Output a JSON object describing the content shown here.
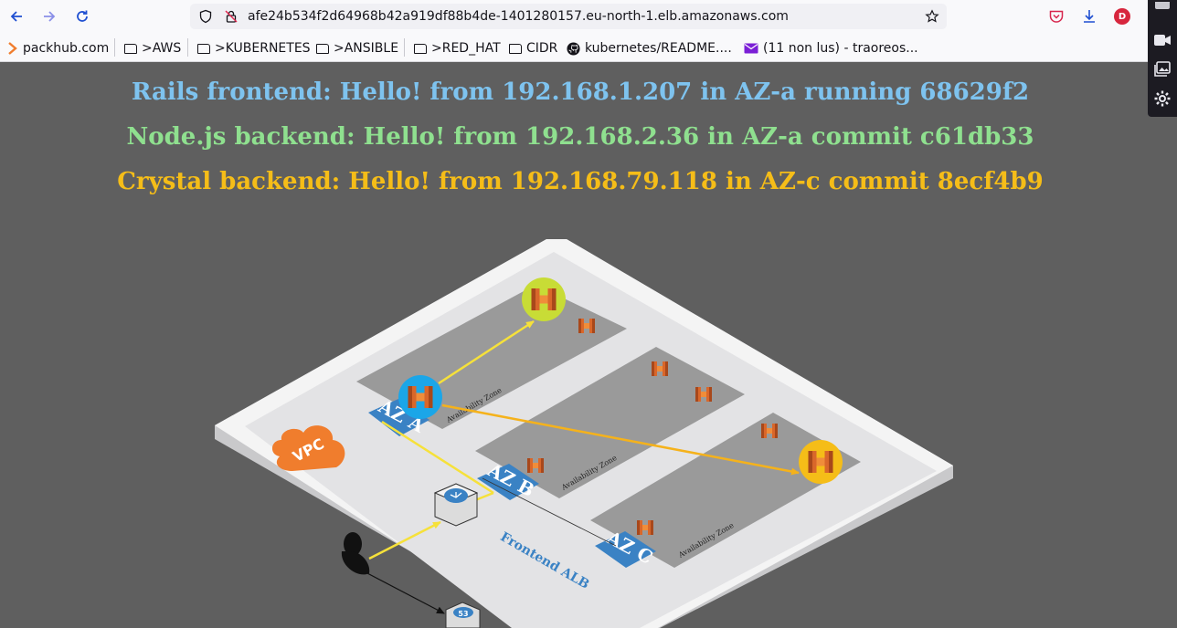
{
  "browser": {
    "url": "afe24b534f2d64968b42a919df88b4de-1401280157.eu-north-1.elb.amazonaws.com",
    "profile_initial": "D"
  },
  "bookmarks": [
    {
      "label": "packhub.com",
      "icon": "packhub-icon"
    },
    {
      "label": ">AWS",
      "icon": "folder-icon"
    },
    {
      "label": ">KUBERNETES",
      "icon": "folder-icon"
    },
    {
      "label": ">ANSIBLE",
      "icon": "folder-icon"
    },
    {
      "label": ">RED_HAT",
      "icon": "folder-icon"
    },
    {
      "label": "CIDR",
      "icon": "folder-icon"
    },
    {
      "label": "kubernetes/README....",
      "icon": "github-icon"
    },
    {
      "label": "(11 non lus) - traoreos...",
      "icon": "mail-icon"
    }
  ],
  "page": {
    "messages": [
      {
        "text": "Rails frontend: Hello! from 192.168.1.207 in AZ-a running 68629f2",
        "color": "#7ec3ef"
      },
      {
        "text": "Node.js backend: Hello! from 192.168.2.36 in AZ-a commit c61db33",
        "color": "#8fe08f"
      },
      {
        "text": "Crystal backend: Hello! from 192.168.79.118 in AZ-c commit 8ecf4b9",
        "color": "#f5bd18"
      }
    ],
    "diagram": {
      "vpc_label": "VPC",
      "alb_label": "Frontend ALB",
      "zones": [
        {
          "tag": "AZ A",
          "caption": "Availability Zone"
        },
        {
          "tag": "AZ B",
          "caption": "Availability Zone"
        },
        {
          "tag": "AZ C",
          "caption": "Availability Zone"
        }
      ],
      "route53_label": "53",
      "colors": {
        "vpc": "#f07d2d",
        "zone_tag": "#3a82c4",
        "frontend_circle": "#1ba6e8",
        "node_circle": "#c8dc36",
        "crystal_circle": "#f5bd18",
        "arrow_yellow": "#f6e13a",
        "arrow_orange": "#f5b21b"
      }
    }
  }
}
